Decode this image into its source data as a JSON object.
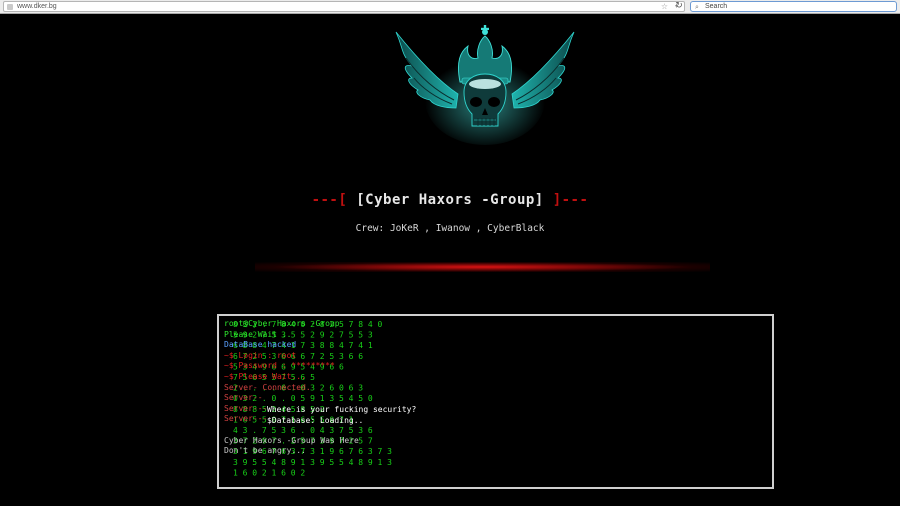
{
  "browser": {
    "url": "www.dker.bg",
    "search_placeholder": "Search"
  },
  "page": {
    "title_left": "---[",
    "title_text": "[Cyber Haxors -Group]",
    "title_right": "]---",
    "crew": "Crew: JoKeR , Iwanow , CyberBlack"
  },
  "terminal": {
    "lines": [
      {
        "text": "root@Cyber Haxors -Group",
        "color": "green"
      },
      {
        "text": "Please Wait ..",
        "color": "green"
      },
      {
        "text": "DataBase hacked",
        "color": "blue"
      },
      {
        "text": "~$ Login : root",
        "color": "red"
      },
      {
        "text": "~$ Password : *********",
        "color": "red"
      },
      {
        "text": "~$ Please Wait...",
        "color": "red"
      },
      {
        "text": "Server- Connected.",
        "color": "redsoft"
      },
      {
        "text": "Server--",
        "color": "redsoft"
      },
      {
        "text": "Server---",
        "color": "redsoft"
      },
      {
        "text": "Server---",
        "color": "redsoft"
      },
      {
        "text": "",
        "color": "gray"
      },
      {
        "text": "Cyber Haxors -Group Was Here",
        "color": "gray"
      },
      {
        "text": "Don't be angry...",
        "color": "gray"
      }
    ],
    "overlay_security": "Where is your fucking security?",
    "overlay_database": "$Database: Loading.."
  },
  "matrix_digits": [
    "8   5 2 .    7   8   4     0   2   8   2   5       7   8   4     0",
    "    5   9   2   7   5   3   5   5   2   9   2   7   5   5   3",
    "    6   8   8   4   7   4   1   7   3   8   8   4   7   4   1",
    "6   7   2   5     3   6   6   6     7   2   5   3     6   6",
    "5   3   4   9   6     6     9   5   4   9   6     6",
    "            7     5   6   5     5     7     5   6   5",
    "        2 . . . . 6 . 0   3     2     6   0   6   3",
    "0   3   2   .   0 .     0   5   9   1   3   5   4   5   0",
    "8   8     8   5   2   4     5   8         5   2",
    "1   6   5   5     0   7     1   6   5   5     0   7     1",
    "    4   3   .   7   5   3   6   .   0   4   3   7   5   3   6",
    "3   7   2   9     7   .   2   5   7   3   9   7     2   5   7",
    "3   1   9   6   7   6   3   7   3   1   9   6   7   6   3   7   3",
    "3   9   5     5   4   8   9   1   3   9   5     5   4   8   9   1   3",
    "    1   6   0     2       1   6   0       2"
  ],
  "colors": {
    "background": "#000000",
    "title_dash": "#c01010",
    "matrix_green": "#18d018",
    "terminal_border": "#cfcfcf"
  }
}
